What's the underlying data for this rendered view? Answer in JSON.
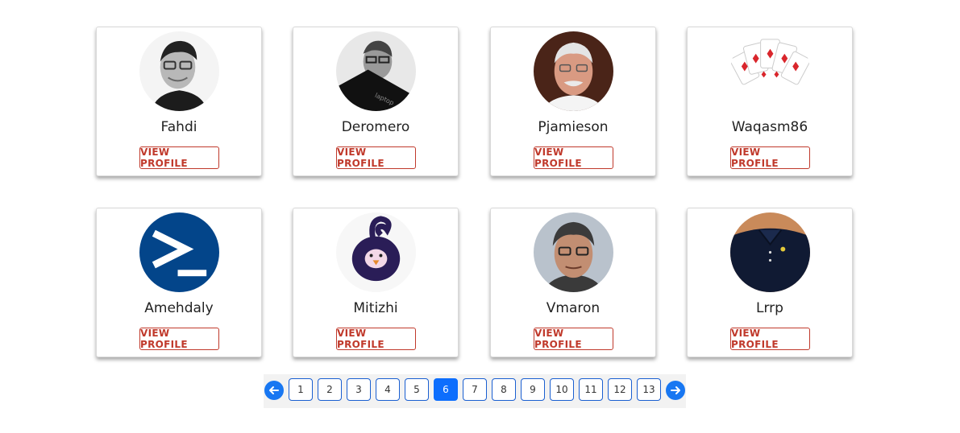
{
  "users": [
    {
      "name": "Fahdi",
      "button": "VIEW PROFILE"
    },
    {
      "name": "Deromero",
      "button": "VIEW PROFILE"
    },
    {
      "name": "Pjamieson",
      "button": "VIEW PROFILE"
    },
    {
      "name": "Waqasm86",
      "button": "VIEW PROFILE"
    },
    {
      "name": "Amehdaly",
      "button": "VIEW PROFILE"
    },
    {
      "name": "Mitizhi",
      "button": "VIEW PROFILE"
    },
    {
      "name": "Vmaron",
      "button": "VIEW PROFILE"
    },
    {
      "name": "Lrrp",
      "button": "VIEW PROFILE"
    }
  ],
  "pagination": {
    "pages": [
      "1",
      "2",
      "3",
      "4",
      "5",
      "6",
      "7",
      "8",
      "9",
      "10",
      "11",
      "12",
      "13"
    ],
    "current": "6",
    "prev_icon": "arrow-left-icon",
    "next_icon": "arrow-right-icon"
  },
  "colors": {
    "accent": "#c0392b",
    "page_active": "#0d6efd",
    "arrow": "#1877f2"
  }
}
